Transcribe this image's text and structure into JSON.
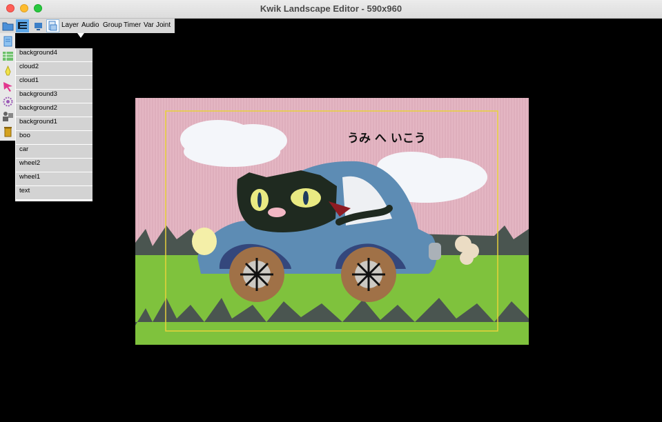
{
  "window": {
    "title": "Kwik Landscape Editor - 590x960"
  },
  "toolbar": {
    "menus": [
      "Layer",
      "Audio",
      "Group",
      "Timer",
      "Var",
      "Joint"
    ]
  },
  "layers": [
    "background4",
    "cloud2",
    "cloud1",
    "background3",
    "background2",
    "background1",
    "boo",
    "car",
    "wheel2",
    "wheel1",
    "text"
  ],
  "canvas": {
    "text": "うみ へ いこう"
  },
  "colors": {
    "sky": "#e4b6c3",
    "grass": "#7fc23d",
    "car": "#5d8cb4",
    "frame": "#e8d23a"
  }
}
